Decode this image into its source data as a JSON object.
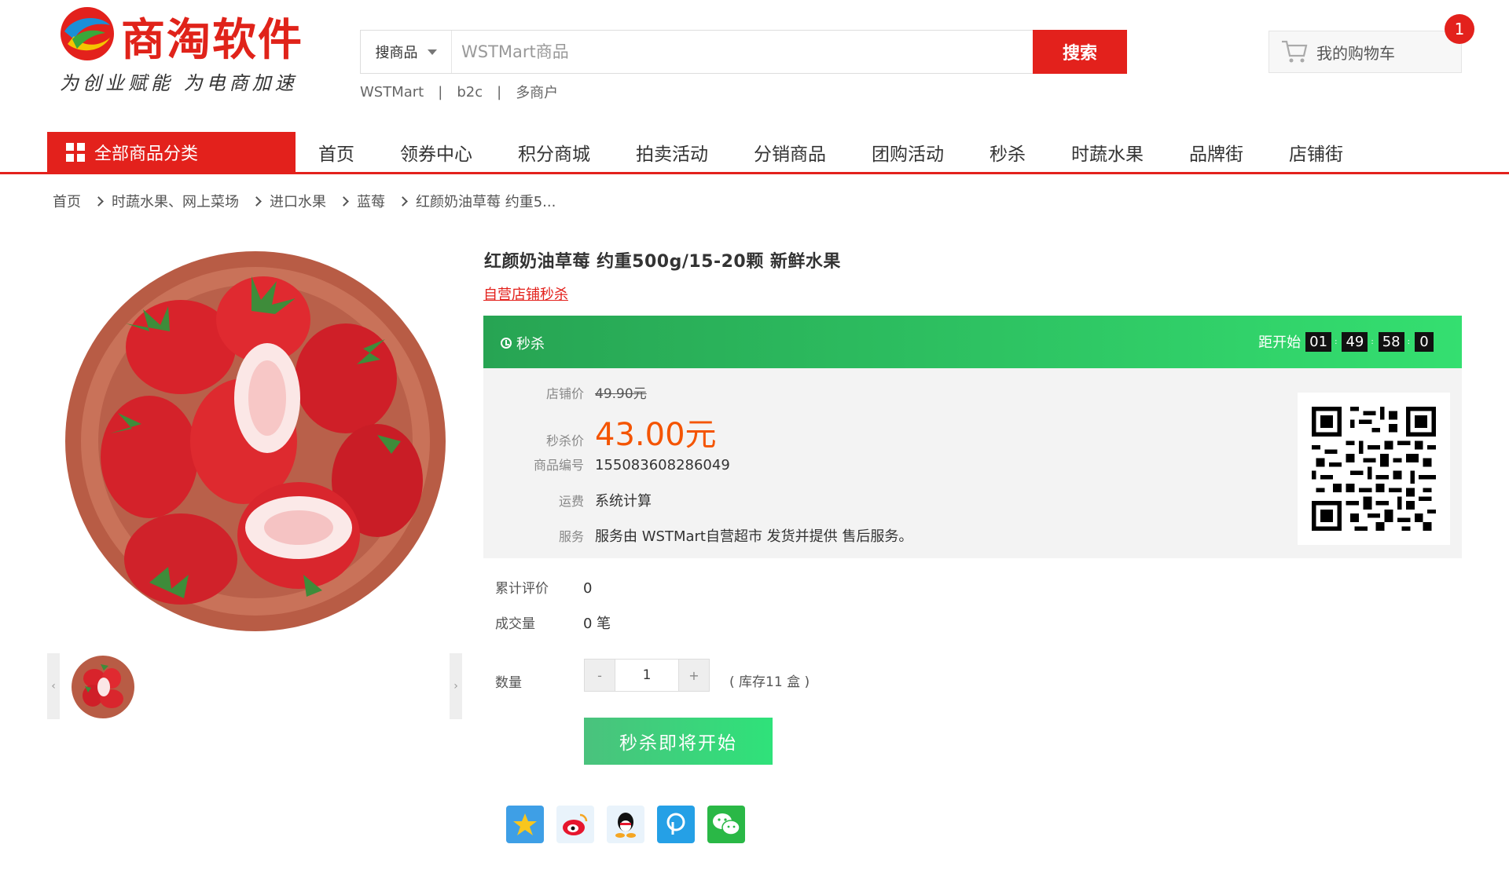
{
  "header": {
    "logo_name": "商淘软件",
    "logo_slogan": "为创业赋能  为电商加速",
    "search_type": "搜商品",
    "search_placeholder": "WSTMart商品",
    "search_button": "搜索",
    "hot_words": [
      "WSTMart",
      "b2c",
      "多商户"
    ],
    "cart_label": "我的购物车",
    "cart_count": "1"
  },
  "nav": {
    "all_categories": "全部商品分类",
    "items": [
      "首页",
      "领券中心",
      "积分商城",
      "拍卖活动",
      "分销商品",
      "团购活动",
      "秒杀",
      "时蔬水果",
      "品牌街",
      "店铺街"
    ]
  },
  "breadcrumb": [
    "首页",
    "时蔬水果、网上菜场",
    "进口水果",
    "蓝莓",
    "红颜奶油草莓 约重5..."
  ],
  "product": {
    "title": "红颜奶油草莓 约重500g/15-20颗 新鲜水果",
    "shop_link": "自营店铺秒杀",
    "flash": {
      "label": "秒杀",
      "countdown_label": "距开始",
      "countdown": [
        "01",
        "49",
        "58",
        "0"
      ]
    },
    "shop_price_label": "店铺价",
    "shop_price": "49.90元",
    "flash_price_label": "秒杀价",
    "flash_price": "43.00元",
    "sku_label": "商品编号",
    "sku": "155083608286049",
    "shipping_label": "运费",
    "shipping": "系统计算",
    "service_label": "服务",
    "service": "服务由 WSTMart自营超市 发货并提供 售后服务。",
    "reviews_label": "累计评价",
    "reviews": "0",
    "sales_label": "成交量",
    "sales": "0 笔",
    "quantity_label": "数量",
    "quantity": "1",
    "minus": "-",
    "plus": "+",
    "stock": "( 库存11 盒 )",
    "buy_button": "秒杀即将开始"
  },
  "colors": {
    "brand_red": "#e3211c",
    "flash_green": "#2fbf5f",
    "price_orange": "#f45400"
  },
  "share_icons": [
    "qzone-icon",
    "weibo-icon",
    "qq-icon",
    "pengyou-icon",
    "wechat-icon"
  ]
}
